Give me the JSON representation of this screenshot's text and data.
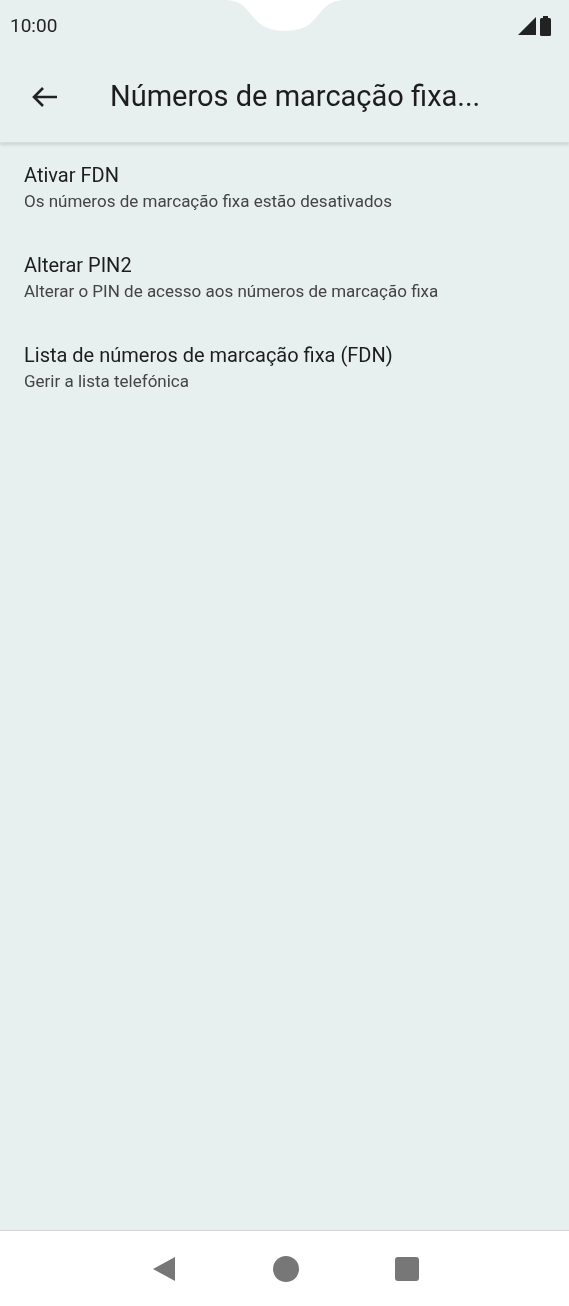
{
  "status_bar": {
    "time": "10:00"
  },
  "app_bar": {
    "title": "Números de marcação fixa..."
  },
  "items": [
    {
      "title": "Ativar FDN",
      "summary": "Os números de marcação fixa estão desativados"
    },
    {
      "title": "Alterar PIN2",
      "summary": "Alterar o PIN de acesso aos números de marcação fixa"
    },
    {
      "title": "Lista de números de marcação fixa (FDN)",
      "summary": "Gerir a lista telefónica"
    }
  ]
}
